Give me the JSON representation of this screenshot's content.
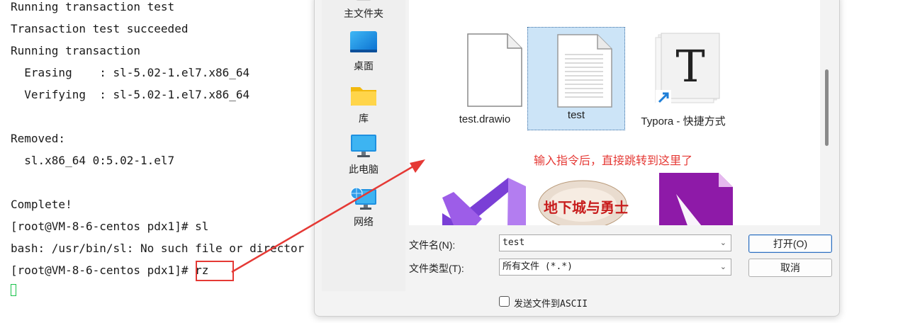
{
  "terminal": {
    "lines": [
      "Running transaction test",
      "Transaction test succeeded",
      "Running transaction",
      "  Erasing    : sl-5.02-1.el7.x86_64",
      "  Verifying  : sl-5.02-1.el7.x86_64",
      "",
      "Removed:",
      "  sl.x86_64 0:5.02-1.el7",
      "",
      "Complete!",
      "[root@VM-8-6-centos pdx1]# sl",
      "bash: /usr/bin/sl: No such file or director",
      "[root@VM-8-6-centos pdx1]# rz"
    ]
  },
  "sidebar": {
    "items": [
      {
        "label": "主文件夹",
        "icon": "home-folder-icon"
      },
      {
        "label": "桌面",
        "icon": "desktop-icon"
      },
      {
        "label": "库",
        "icon": "library-folder-icon"
      },
      {
        "label": "此电脑",
        "icon": "computer-icon"
      },
      {
        "label": "网络",
        "icon": "network-icon"
      }
    ]
  },
  "files": [
    {
      "name": "test.drawio",
      "icon": "blank-document-icon",
      "selected": false
    },
    {
      "name": "test",
      "icon": "text-document-icon",
      "selected": true
    },
    {
      "name": "Typora - 快捷方式",
      "icon": "typora-shortcut-icon",
      "selected": false
    },
    {
      "name": "",
      "icon": "visual-studio-icon"
    },
    {
      "name": "",
      "icon": "game-app-icon",
      "logo_text": "地下城与勇士"
    },
    {
      "name": "",
      "icon": "purple-document-icon"
    }
  ],
  "annotation": "输入指令后，直接跳转到这里了",
  "form": {
    "filename_label": "文件名(N):",
    "filename_value": "test",
    "filetype_label": "文件类型(T):",
    "filetype_value": "所有文件 (*.*)",
    "open_button": "打开(O)",
    "cancel_button": "取消",
    "ascii_checkbox_label": "发送文件到ASCII",
    "ascii_checked": false
  },
  "colors": {
    "annotation_red": "#e53935",
    "selection_blue": "#cce4f7",
    "cursor_green": "#19c24a"
  }
}
